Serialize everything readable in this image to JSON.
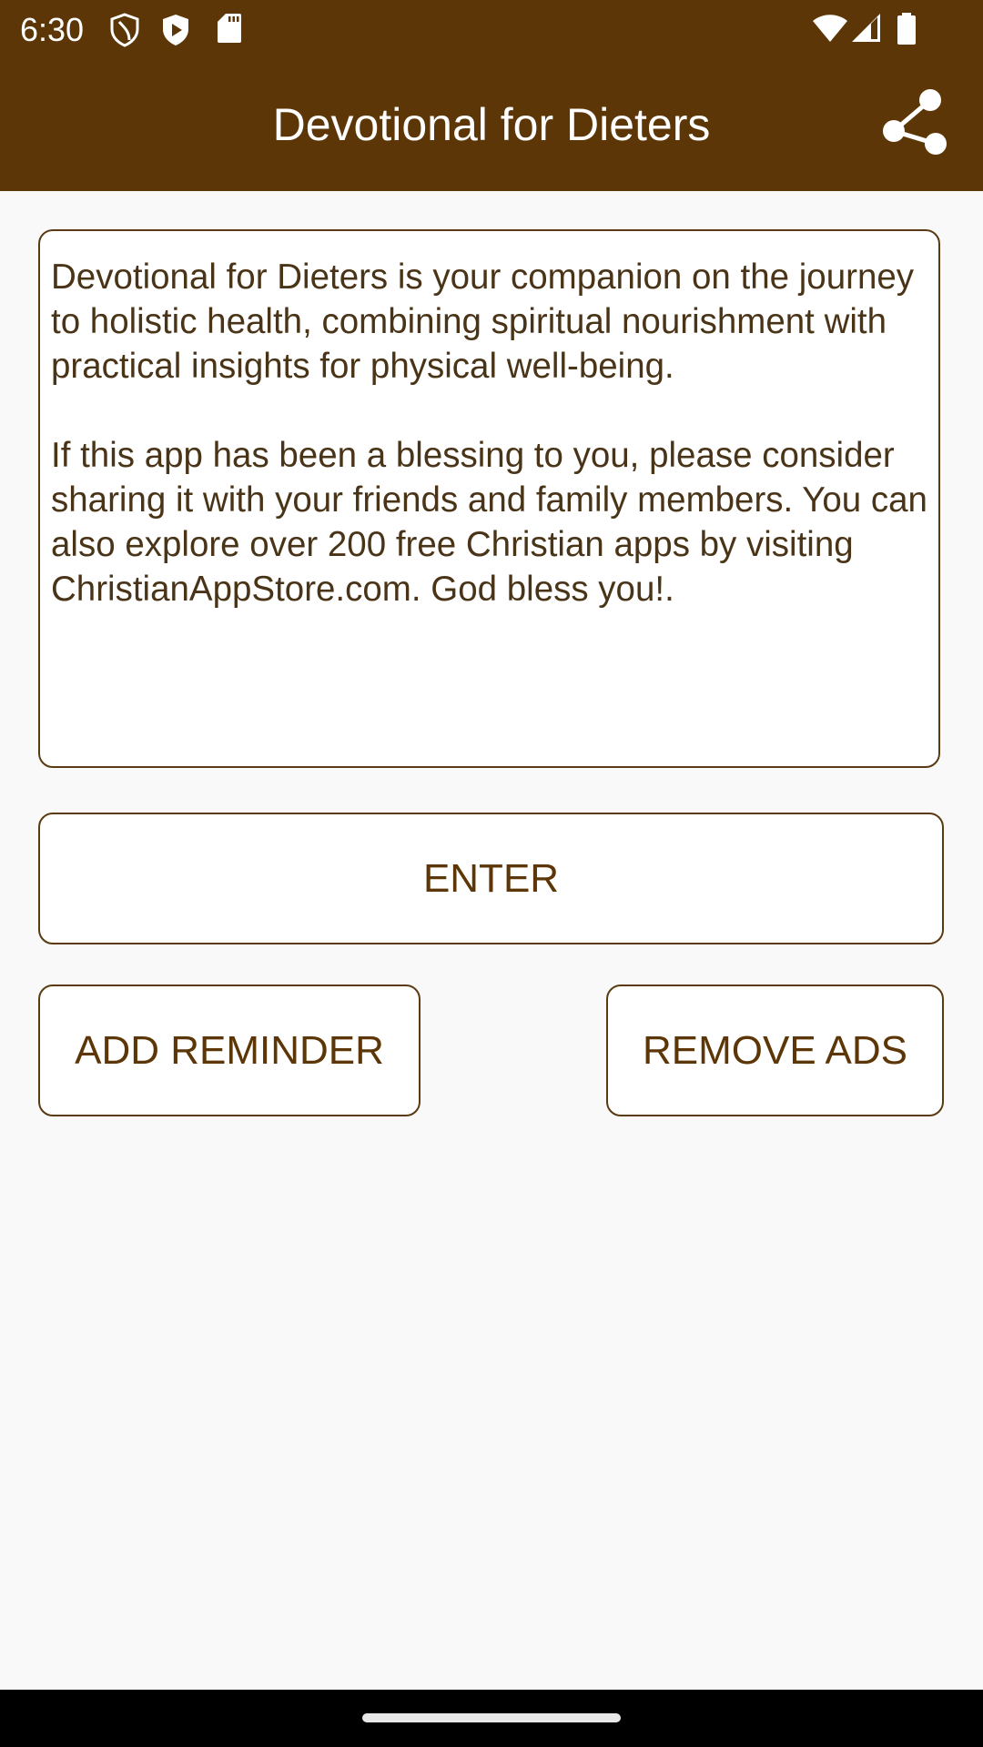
{
  "status_bar": {
    "time": "6:30",
    "icons": [
      "shield-icon",
      "play-protect-icon",
      "sd-card-icon",
      "wifi-icon",
      "signal-icon",
      "battery-icon"
    ]
  },
  "app_bar": {
    "title": "Devotional for Dieters",
    "share_icon": "share-icon"
  },
  "description": {
    "text": "Devotional for Dieters is your companion on the journey to holistic health, combining spiritual nourishment with practical insights for physical well-being.\n\nIf this app has been a blessing to you, please consider sharing it with your friends and family members. You can also explore over 200 free Christian apps by visiting ChristianAppStore.com. God bless you!."
  },
  "buttons": {
    "enter": "ENTER",
    "add_reminder": "ADD REMINDER",
    "remove_ads": "REMOVE ADS"
  },
  "colors": {
    "primary": "#5c3606",
    "text": "#4a3418",
    "background": "#f9f9f9"
  }
}
